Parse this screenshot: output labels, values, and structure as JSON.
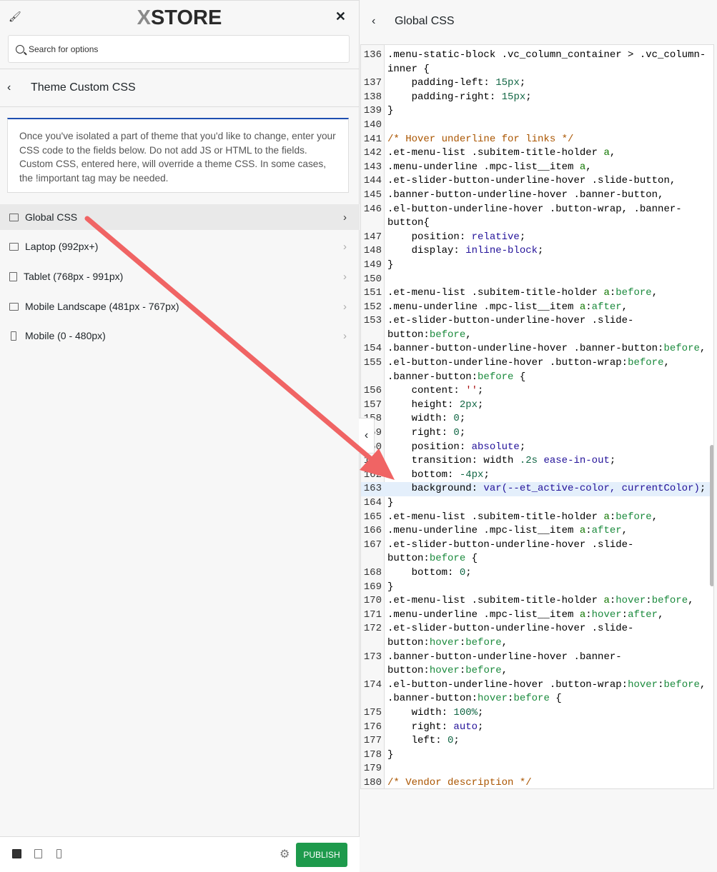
{
  "left": {
    "logo": "XSTORE",
    "search": {
      "placeholder": "Search for options"
    },
    "section_title": "Theme Custom CSS",
    "description": "Once you've isolated a part of theme that you'd like to change, enter your CSS code to the fields below. Do not add JS or HTML to the fields. Custom CSS, entered here, will override a theme CSS. In some cases, the !important tag may be needed.",
    "items": [
      {
        "label": "Global CSS",
        "icon": "desktop-icon",
        "active": true
      },
      {
        "label": "Laptop (992px+)",
        "icon": "laptop-icon"
      },
      {
        "label": "Tablet (768px - 991px)",
        "icon": "tablet-icon"
      },
      {
        "label": "Mobile Landscape (481px - 767px)",
        "icon": "mobile-landscape-icon"
      },
      {
        "label": "Mobile (0 - 480px)",
        "icon": "mobile-icon"
      }
    ],
    "publish": "PUBLISH"
  },
  "right": {
    "title": "Global CSS",
    "highlighted_line": "163",
    "rows": [
      {
        "n": "136",
        "t": [
          [
            "s",
            ".menu-static-block .vc_column_container > .vc_column-"
          ]
        ]
      },
      {
        "n": "",
        "t": [
          [
            "s",
            "inner {"
          ]
        ]
      },
      {
        "n": "137",
        "t": [
          [
            "p",
            "    padding-left: "
          ],
          [
            "num",
            "15px"
          ],
          [
            "p",
            ";"
          ]
        ]
      },
      {
        "n": "138",
        "t": [
          [
            "p",
            "    padding-right: "
          ],
          [
            "num",
            "15px"
          ],
          [
            "p",
            ";"
          ]
        ]
      },
      {
        "n": "139",
        "t": [
          [
            "p",
            "}"
          ]
        ]
      },
      {
        "n": "140",
        "t": []
      },
      {
        "n": "141",
        "t": [
          [
            "cm",
            "/* Hover underline for links */"
          ]
        ]
      },
      {
        "n": "142",
        "t": [
          [
            "s",
            ".et-menu-list .subitem-title-holder "
          ],
          [
            "tag",
            "a"
          ],
          [
            "s",
            ","
          ]
        ]
      },
      {
        "n": "143",
        "t": [
          [
            "s",
            ".menu-underline .mpc-list__item "
          ],
          [
            "tag",
            "a"
          ],
          [
            "s",
            ","
          ]
        ]
      },
      {
        "n": "144",
        "t": [
          [
            "s",
            ".et-slider-button-underline-hover .slide-button,"
          ]
        ]
      },
      {
        "n": "145",
        "t": [
          [
            "s",
            ".banner-button-underline-hover .banner-button,"
          ]
        ]
      },
      {
        "n": "146",
        "t": [
          [
            "s",
            ".el-button-underline-hover .button-wrap, .banner-"
          ]
        ]
      },
      {
        "n": "",
        "t": [
          [
            "s",
            "button{"
          ]
        ]
      },
      {
        "n": "147",
        "t": [
          [
            "p",
            "    position: "
          ],
          [
            "kw",
            "relative"
          ],
          [
            "p",
            ";"
          ]
        ]
      },
      {
        "n": "148",
        "t": [
          [
            "p",
            "    display: "
          ],
          [
            "kw",
            "inline-block"
          ],
          [
            "p",
            ";"
          ]
        ]
      },
      {
        "n": "149",
        "t": [
          [
            "p",
            "}"
          ]
        ]
      },
      {
        "n": "150",
        "t": []
      },
      {
        "n": "151",
        "t": [
          [
            "s",
            ".et-menu-list .subitem-title-holder "
          ],
          [
            "tag",
            "a"
          ],
          [
            "s",
            ":"
          ],
          [
            "ps",
            "before"
          ],
          [
            "s",
            ","
          ]
        ]
      },
      {
        "n": "152",
        "t": [
          [
            "s",
            ".menu-underline .mpc-list__item "
          ],
          [
            "tag",
            "a"
          ],
          [
            "s",
            ":"
          ],
          [
            "ps",
            "after"
          ],
          [
            "s",
            ","
          ]
        ]
      },
      {
        "n": "153",
        "t": [
          [
            "s",
            ".et-slider-button-underline-hover .slide-"
          ]
        ]
      },
      {
        "n": "",
        "t": [
          [
            "s",
            "button:"
          ],
          [
            "ps",
            "before"
          ],
          [
            "s",
            ","
          ]
        ]
      },
      {
        "n": "154",
        "t": [
          [
            "s",
            ".banner-button-underline-hover .banner-button:"
          ],
          [
            "ps",
            "before"
          ],
          [
            "s",
            ","
          ]
        ]
      },
      {
        "n": "155",
        "t": [
          [
            "s",
            ".el-button-underline-hover .button-wrap:"
          ],
          [
            "ps",
            "before"
          ],
          [
            "s",
            ","
          ]
        ]
      },
      {
        "n": "",
        "t": [
          [
            "s",
            ".banner-button:"
          ],
          [
            "ps",
            "before"
          ],
          [
            "s",
            " {"
          ]
        ]
      },
      {
        "n": "156",
        "t": [
          [
            "p",
            "    content: "
          ],
          [
            "str",
            "''"
          ],
          [
            "p",
            ";"
          ]
        ]
      },
      {
        "n": "157",
        "t": [
          [
            "p",
            "    height: "
          ],
          [
            "num",
            "2px"
          ],
          [
            "p",
            ";"
          ]
        ]
      },
      {
        "n": "158",
        "t": [
          [
            "p",
            "    width: "
          ],
          [
            "num",
            "0"
          ],
          [
            "p",
            ";"
          ]
        ]
      },
      {
        "n": "159",
        "t": [
          [
            "p",
            "    right: "
          ],
          [
            "num",
            "0"
          ],
          [
            "p",
            ";"
          ]
        ]
      },
      {
        "n": "160",
        "t": [
          [
            "p",
            "    position: "
          ],
          [
            "kw",
            "absolute"
          ],
          [
            "p",
            ";"
          ]
        ]
      },
      {
        "n": "161",
        "t": [
          [
            "p",
            "    transition: width "
          ],
          [
            "num",
            ".2s"
          ],
          [
            "p",
            " "
          ],
          [
            "kw",
            "ease-in-out"
          ],
          [
            "p",
            ";"
          ]
        ]
      },
      {
        "n": "162",
        "t": [
          [
            "p",
            "    bottom: "
          ],
          [
            "num",
            "-4px"
          ],
          [
            "p",
            ";"
          ]
        ]
      },
      {
        "n": "163",
        "t": [
          [
            "p",
            "    background: "
          ],
          [
            "kw",
            "var(--et_active-color, currentColor)"
          ],
          [
            "p",
            ";"
          ]
        ]
      },
      {
        "n": "164",
        "t": [
          [
            "p",
            "}"
          ]
        ]
      },
      {
        "n": "165",
        "t": [
          [
            "s",
            ".et-menu-list .subitem-title-holder "
          ],
          [
            "tag",
            "a"
          ],
          [
            "s",
            ":"
          ],
          [
            "ps",
            "before"
          ],
          [
            "s",
            ","
          ]
        ]
      },
      {
        "n": "166",
        "t": [
          [
            "s",
            ".menu-underline .mpc-list__item "
          ],
          [
            "tag",
            "a"
          ],
          [
            "s",
            ":"
          ],
          [
            "ps",
            "after"
          ],
          [
            "s",
            ","
          ]
        ]
      },
      {
        "n": "167",
        "t": [
          [
            "s",
            ".et-slider-button-underline-hover .slide-"
          ]
        ]
      },
      {
        "n": "",
        "t": [
          [
            "s",
            "button:"
          ],
          [
            "ps",
            "before"
          ],
          [
            "s",
            " {"
          ]
        ]
      },
      {
        "n": "168",
        "t": [
          [
            "p",
            "    bottom: "
          ],
          [
            "num",
            "0"
          ],
          [
            "p",
            ";"
          ]
        ]
      },
      {
        "n": "169",
        "t": [
          [
            "p",
            "}"
          ]
        ]
      },
      {
        "n": "170",
        "t": [
          [
            "s",
            ".et-menu-list .subitem-title-holder "
          ],
          [
            "tag",
            "a"
          ],
          [
            "s",
            ":"
          ],
          [
            "ps",
            "hover"
          ],
          [
            "s",
            ":"
          ],
          [
            "ps",
            "before"
          ],
          [
            "s",
            ","
          ]
        ]
      },
      {
        "n": "171",
        "t": [
          [
            "s",
            ".menu-underline .mpc-list__item "
          ],
          [
            "tag",
            "a"
          ],
          [
            "s",
            ":"
          ],
          [
            "ps",
            "hover"
          ],
          [
            "s",
            ":"
          ],
          [
            "ps",
            "after"
          ],
          [
            "s",
            ","
          ]
        ]
      },
      {
        "n": "172",
        "t": [
          [
            "s",
            ".et-slider-button-underline-hover .slide-"
          ]
        ]
      },
      {
        "n": "",
        "t": [
          [
            "s",
            "button:"
          ],
          [
            "ps",
            "hover"
          ],
          [
            "s",
            ":"
          ],
          [
            "ps",
            "before"
          ],
          [
            "s",
            ","
          ]
        ]
      },
      {
        "n": "173",
        "t": [
          [
            "s",
            ".banner-button-underline-hover .banner-"
          ]
        ]
      },
      {
        "n": "",
        "t": [
          [
            "s",
            "button:"
          ],
          [
            "ps",
            "hover"
          ],
          [
            "s",
            ":"
          ],
          [
            "ps",
            "before"
          ],
          [
            "s",
            ","
          ]
        ]
      },
      {
        "n": "174",
        "t": [
          [
            "s",
            ".el-button-underline-hover .button-wrap:"
          ],
          [
            "ps",
            "hover"
          ],
          [
            "s",
            ":"
          ],
          [
            "ps",
            "before"
          ],
          [
            "s",
            ","
          ]
        ]
      },
      {
        "n": "",
        "t": [
          [
            "s",
            ".banner-button:"
          ],
          [
            "ps",
            "hover"
          ],
          [
            "s",
            ":"
          ],
          [
            "ps",
            "before"
          ],
          [
            "s",
            " {"
          ]
        ]
      },
      {
        "n": "175",
        "t": [
          [
            "p",
            "    width: "
          ],
          [
            "num",
            "100%"
          ],
          [
            "p",
            ";"
          ]
        ]
      },
      {
        "n": "176",
        "t": [
          [
            "p",
            "    right: "
          ],
          [
            "kw",
            "auto"
          ],
          [
            "p",
            ";"
          ]
        ]
      },
      {
        "n": "177",
        "t": [
          [
            "p",
            "    left: "
          ],
          [
            "num",
            "0"
          ],
          [
            "p",
            ";"
          ]
        ]
      },
      {
        "n": "178",
        "t": [
          [
            "p",
            "}"
          ]
        ]
      },
      {
        "n": "179",
        "t": []
      },
      {
        "n": "180",
        "t": [
          [
            "cm",
            "/* Vendor description */"
          ]
        ]
      }
    ]
  },
  "colors": {
    "accent_blue": "#1e4fb0",
    "publish_green": "#1e9a4c",
    "annotation_arrow": "#f06464"
  }
}
